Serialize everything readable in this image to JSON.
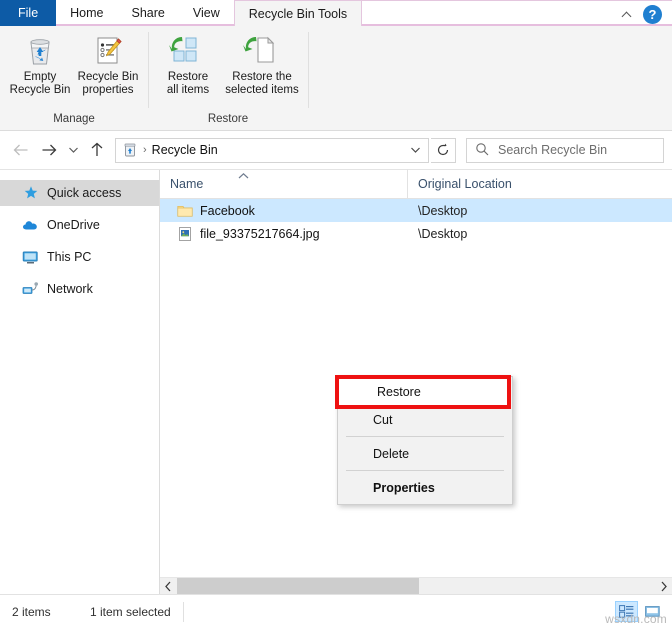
{
  "window": {
    "tabs": [
      {
        "id": "file",
        "label": "File"
      },
      {
        "id": "home",
        "label": "Home"
      },
      {
        "id": "share",
        "label": "Share"
      },
      {
        "id": "view",
        "label": "View"
      }
    ],
    "contextual_tab": "Recycle Bin Tools",
    "help_label": "?"
  },
  "ribbon": {
    "groups": [
      {
        "label": "Manage",
        "buttons": [
          {
            "id": "empty-recycle-bin",
            "label": "Empty\nRecycle Bin",
            "icon": "recycle-bin-icon"
          },
          {
            "id": "recycle-bin-properties",
            "label": "Recycle Bin\nproperties",
            "icon": "properties-icon"
          }
        ]
      },
      {
        "label": "Restore",
        "buttons": [
          {
            "id": "restore-all-items",
            "label": "Restore\nall items",
            "icon": "restore-all-icon"
          },
          {
            "id": "restore-selected-items",
            "label": "Restore the\nselected items",
            "icon": "restore-selected-icon"
          }
        ]
      }
    ]
  },
  "address": {
    "back_icon": "arrow-left-icon",
    "forward_icon": "arrow-right-icon",
    "history_icon": "chevron-down-icon",
    "up_icon": "arrow-up-icon",
    "location_icon": "recycle-bin-small-icon",
    "separator": "›",
    "path": "Recycle Bin",
    "dropdown_icon": "chevron-down-icon",
    "refresh_icon": "refresh-icon"
  },
  "search": {
    "icon": "search-icon",
    "placeholder": "Search Recycle Bin"
  },
  "sidebar": {
    "items": [
      {
        "id": "quick-access",
        "label": "Quick access",
        "icon": "star-icon",
        "selected": true
      },
      {
        "id": "onedrive",
        "label": "OneDrive",
        "icon": "cloud-icon",
        "selected": false
      },
      {
        "id": "this-pc",
        "label": "This PC",
        "icon": "monitor-icon",
        "selected": false
      },
      {
        "id": "network",
        "label": "Network",
        "icon": "network-icon",
        "selected": false
      }
    ]
  },
  "filelist": {
    "columns": [
      {
        "id": "name",
        "label": "Name",
        "sorted": "asc"
      },
      {
        "id": "original-location",
        "label": "Original Location"
      }
    ],
    "sort_indicator": "︿",
    "rows": [
      {
        "name": "Facebook",
        "location": "\\Desktop",
        "icon": "folder-icon",
        "selected": true
      },
      {
        "name": "file_93375217664.jpg",
        "location": "\\Desktop",
        "icon": "image-file-icon",
        "selected": false
      }
    ]
  },
  "context_menu": {
    "items": [
      {
        "id": "restore",
        "label": "Restore",
        "bold": false,
        "highlighted": true
      },
      {
        "id": "cut",
        "label": "Cut",
        "bold": false,
        "highlighted": false
      },
      {
        "id": "sep-1",
        "separator": true
      },
      {
        "id": "delete",
        "label": "Delete",
        "bold": false,
        "highlighted": false
      },
      {
        "id": "sep-2",
        "separator": true
      },
      {
        "id": "properties",
        "label": "Properties",
        "bold": true,
        "highlighted": false
      }
    ],
    "highlight_color": "#ee1111"
  },
  "statusbar": {
    "item_count": "2 items",
    "selection": "1 item selected",
    "view_details_icon": "details-view-icon",
    "view_large_icon": "large-icons-view-icon"
  },
  "watermark": "wsxdn.com",
  "colors": {
    "file_tab": "#0d5ba6",
    "selection": "#cce8ff",
    "ribbon_bg": "#f4f4f4",
    "annotation_red": "#ee1111"
  }
}
